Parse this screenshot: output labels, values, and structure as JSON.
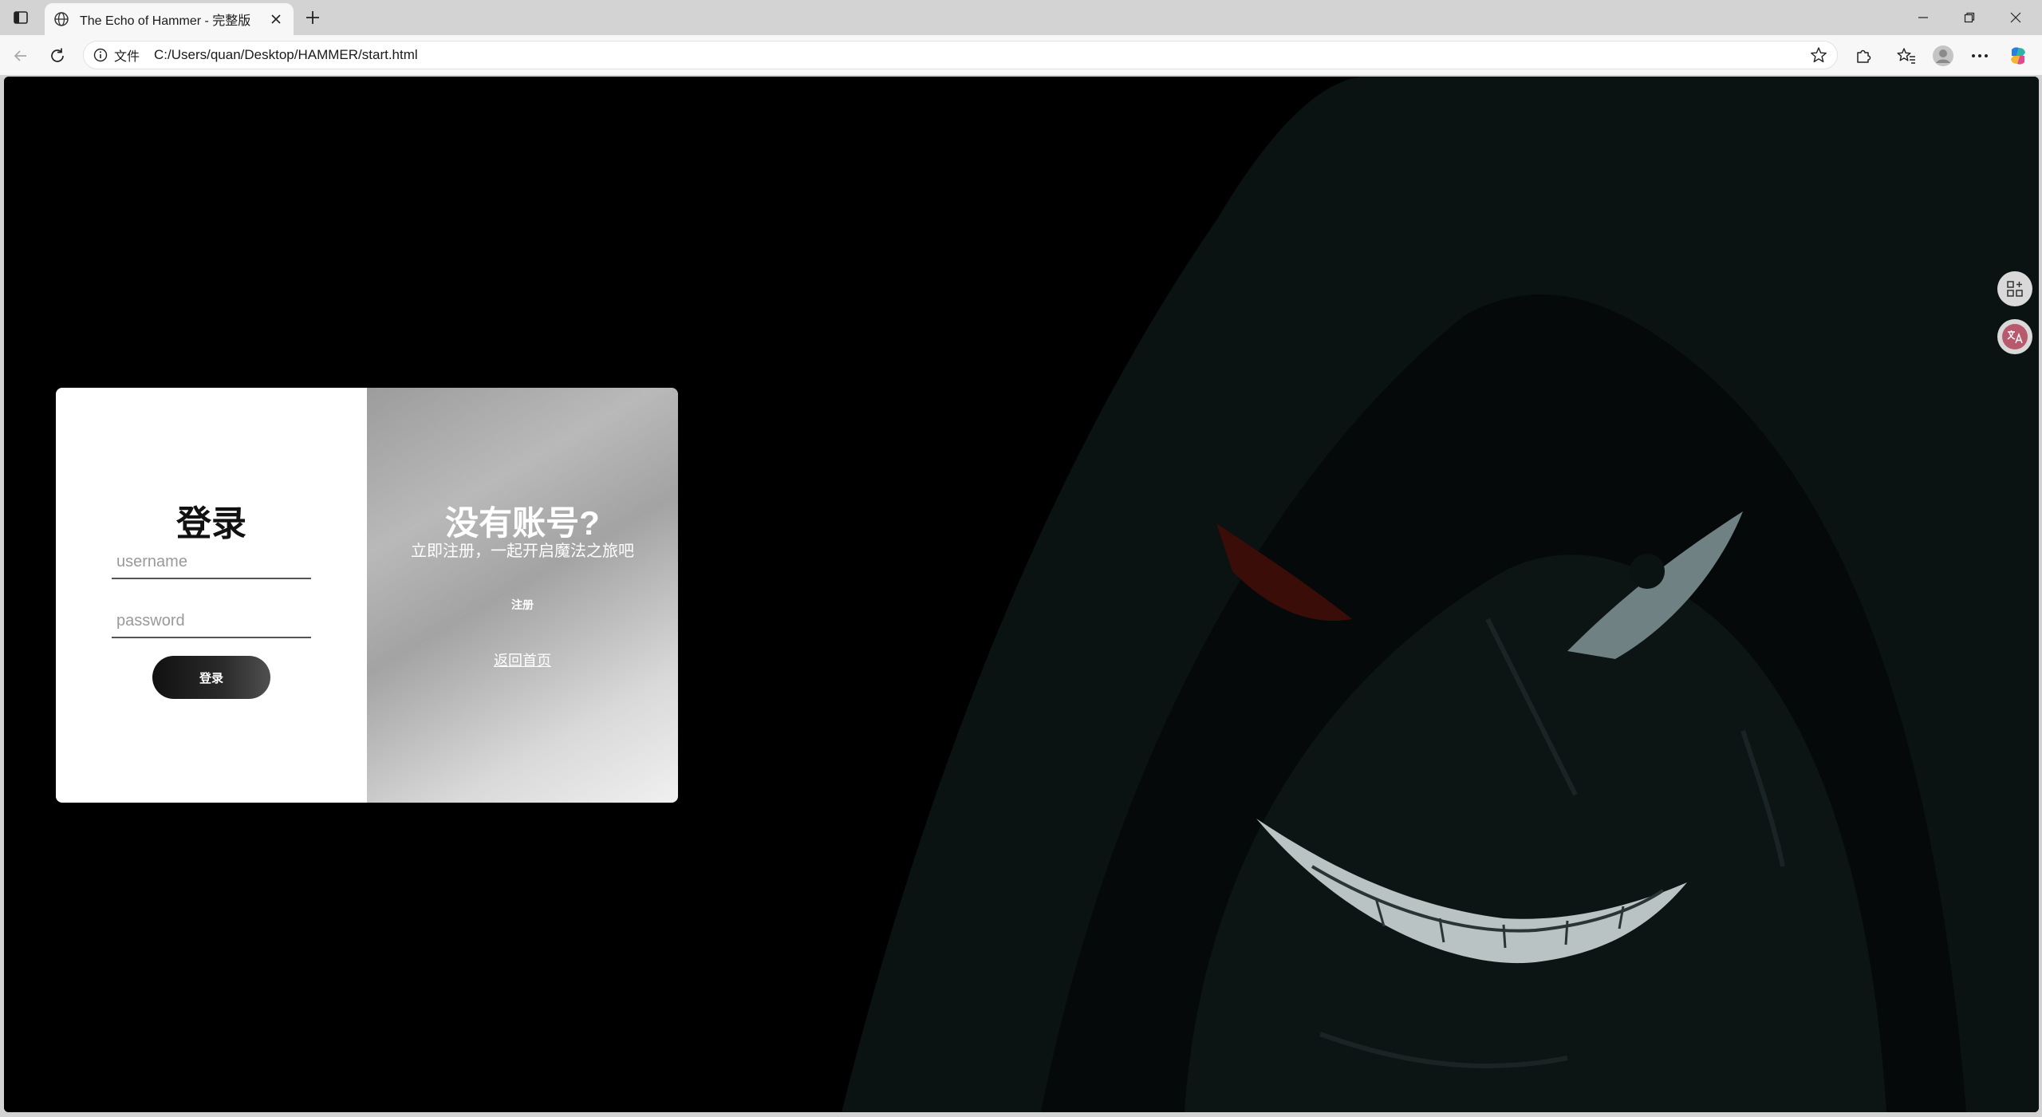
{
  "tab": {
    "title": "The Echo of Hammer - 完整版"
  },
  "address": {
    "scheme_label": "文件",
    "url": "C:/Users/quan/Desktop/HAMMER/start.html"
  },
  "login": {
    "title": "登录",
    "username_placeholder": "username",
    "password_placeholder": "password",
    "button_label": "登录"
  },
  "register": {
    "title": "没有账号?",
    "subtitle": "立即注册，一起开启魔法之旅吧",
    "button_label": "注册",
    "home_link": "返回首页"
  },
  "icons": {
    "tab_actions": "tab-actions-icon",
    "favicon": "globe-icon",
    "tab_close": "close-icon",
    "new_tab": "plus-icon",
    "minimize": "minimize-icon",
    "restore": "restore-icon",
    "window_close": "close-icon",
    "back": "back-arrow-icon",
    "refresh": "refresh-icon",
    "site_info": "info-icon",
    "favorite": "star-icon",
    "extensions": "puzzle-icon",
    "favorites_bar": "favorites-icon",
    "profile": "profile-icon",
    "more": "more-icon",
    "copilot": "copilot-icon",
    "side_apps": "apps-add-icon",
    "side_translate": "translate-icon"
  },
  "colors": {
    "chrome_bg": "#d3d3d3",
    "toolbar_bg": "#f7f7f7",
    "page_bg": "#000000",
    "card_left": "#ffffff",
    "login_button": "#111111",
    "translate_badge": "#b85a6e"
  }
}
